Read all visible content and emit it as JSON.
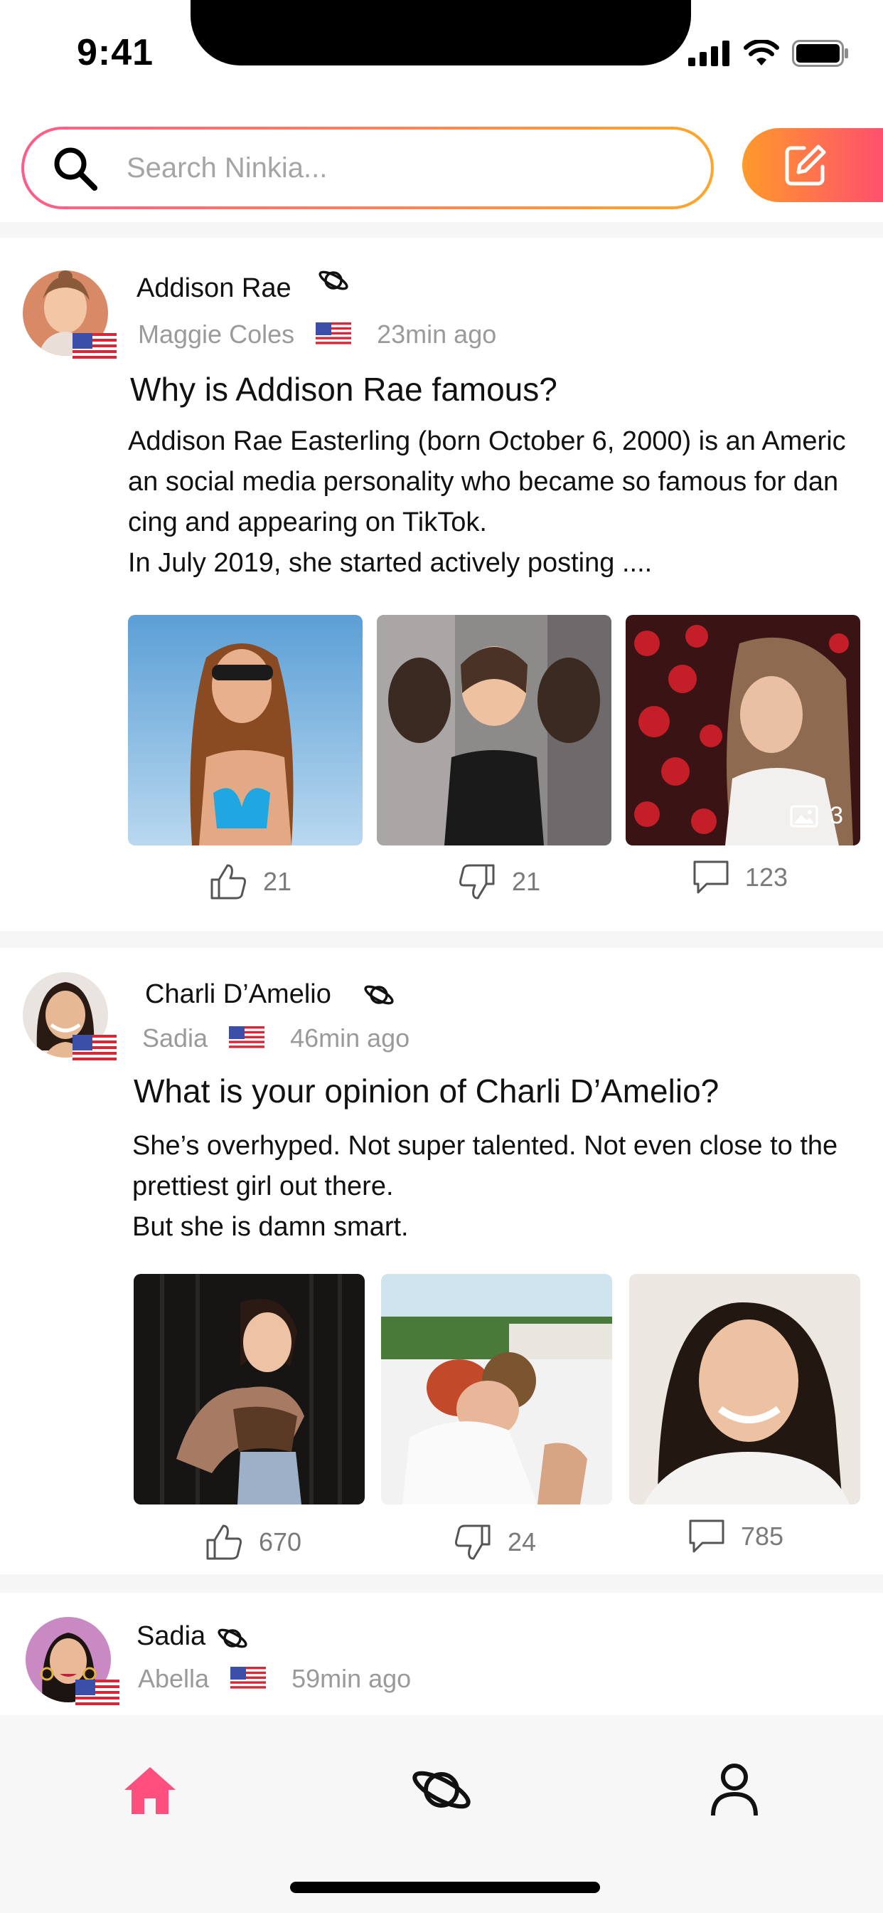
{
  "status_bar": {
    "time": "9:41"
  },
  "search": {
    "placeholder": "Search Ninkia..."
  },
  "colors": {
    "accent_pink": "#ff4f7e",
    "accent_orange": "#ff9a2a",
    "home_active": "#ff4f7e"
  },
  "posts": [
    {
      "author": "Addison Rae",
      "sub_author": "Maggie Coles",
      "time": "23min ago",
      "title": "Why is Addison Rae famous?",
      "body": "Addison Rae Easterling (born October 6, 2000) is an American social media personality who became so famous for dancing and appearing on TikTok.\nIn July 2019, she started actively posting ....",
      "photo_count": "3",
      "likes": "21",
      "dislikes": "21",
      "comments": "123"
    },
    {
      "author": "Charli D’Amelio",
      "sub_author": "Sadia",
      "time": "46min ago",
      "title": "What is your opinion of Charli D’Amelio?",
      "body": "She’s overhyped. Not super talented. Not even close to the prettiest girl out there.\nBut she is damn smart.",
      "likes": "670",
      "dislikes": "24",
      "comments": "785"
    },
    {
      "author": "Sadia",
      "sub_author": "Abella",
      "time": "59min ago"
    }
  ],
  "nav": {
    "items": [
      "home-icon",
      "planet-icon",
      "profile-icon"
    ],
    "active": "home"
  }
}
